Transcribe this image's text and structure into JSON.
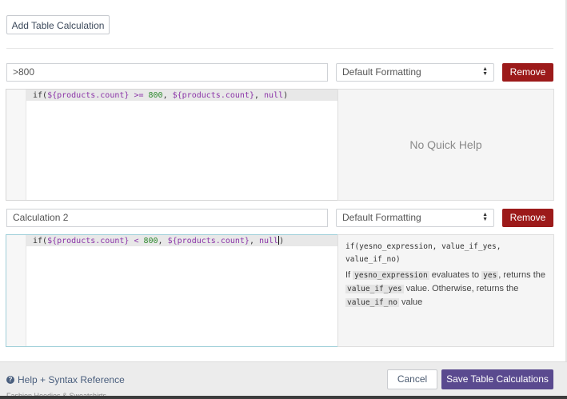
{
  "toolbar": {
    "add_label": "Add Table Calculation"
  },
  "calculations": [
    {
      "name": ">800",
      "formatting": "Default Formatting",
      "remove_label": "Remove",
      "code": {
        "fn": "if(",
        "var1": "${products.count}",
        "op": " >= ",
        "num": "800",
        "sep1": ", ",
        "var2": "${products.count}",
        "sep2": ", ",
        "null": "null",
        "close": ")"
      },
      "help": {
        "no_help": "No Quick Help"
      }
    },
    {
      "name": "Calculation 2",
      "formatting": "Default Formatting",
      "remove_label": "Remove",
      "code": {
        "fn": "if(",
        "var1": "${products.count}",
        "op": " < ",
        "num": "800",
        "sep1": ", ",
        "var2": "${products.count}",
        "sep2": ", ",
        "null": "null",
        "close": ")"
      },
      "help": {
        "signature_line1": "if(yesno_expression, value_if_yes,",
        "signature_line2": "value_if_no)",
        "desc_part1": "If ",
        "tag1": "yesno_expression",
        "desc_part2": " evaluates to ",
        "tag2": "yes",
        "desc_part3": ", returns the ",
        "tag3": "value_if_yes",
        "desc_part4": " value. Otherwise, returns the ",
        "tag4": "value_if_no",
        "desc_part5": " value"
      }
    }
  ],
  "footer": {
    "help_label": "Help + Syntax Reference",
    "cancel_label": "Cancel",
    "save_label": "Save Table Calculations",
    "ghost_text": "Fashion Hoodies & Sweatshirts"
  },
  "colors": {
    "remove": "#9c1a1a",
    "save": "#5a4a8f",
    "link": "#4a5f7e"
  }
}
